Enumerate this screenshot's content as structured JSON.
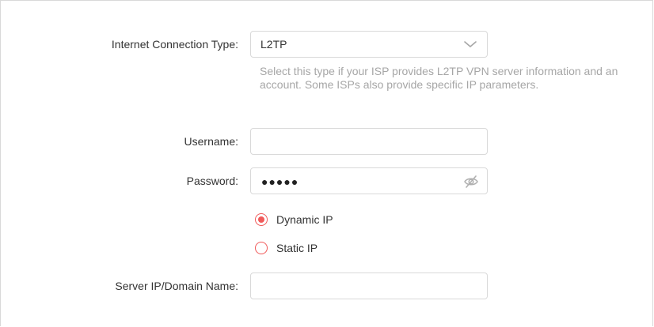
{
  "form": {
    "connection_type": {
      "label": "Internet Connection Type:",
      "selected": "L2TP",
      "hint": "Select this type if your ISP provides L2TP VPN server information and an account. Some ISPs also provide specific IP parameters."
    },
    "username": {
      "label": "Username:",
      "value": ""
    },
    "password": {
      "label": "Password:",
      "masked_value": "●●●●●"
    },
    "ip_mode": {
      "options": [
        {
          "label": "Dynamic IP",
          "checked": true
        },
        {
          "label": "Static IP",
          "checked": false
        }
      ]
    },
    "server": {
      "label": "Server IP/Domain Name:",
      "value": ""
    }
  },
  "colors": {
    "accent": "#f05a5a",
    "border": "#d9d9d9",
    "hint": "#a6a6a6",
    "text": "#333333"
  },
  "icons": {
    "select": "chevron-down-icon",
    "password_toggle": "eye-slash-icon"
  }
}
